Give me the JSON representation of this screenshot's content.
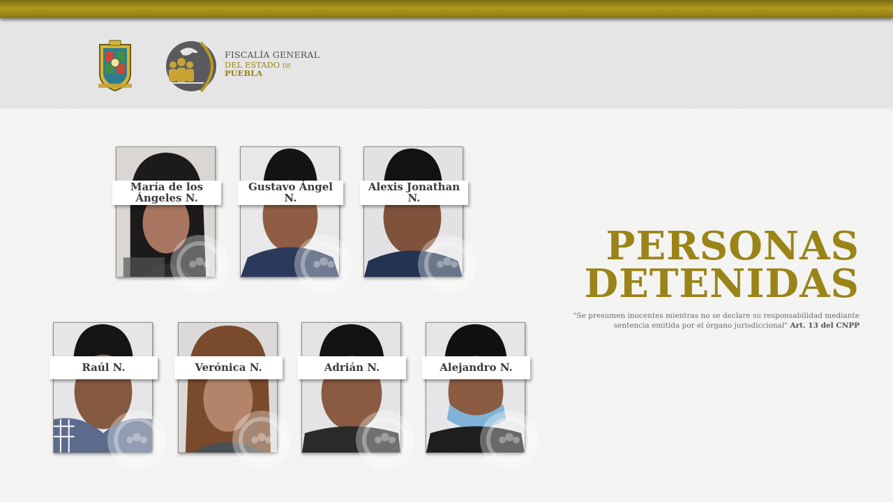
{
  "header": {
    "coat_of_arms": "puebla-coat-of-arms",
    "agency_line1": "FISCALÍA GENERAL",
    "agency_line2_a": "DEL ESTADO",
    "agency_line2_b": "DE",
    "agency_line3": "PUEBLA"
  },
  "title": {
    "line1": "PERSONAS",
    "line2": "DETENIDAS"
  },
  "disclaimer": {
    "line1": "\"Se presumen inocentes mientras no se declare su responsabilidad mediante",
    "line2": "sentencia emitida por el órgano jurisdiccional\"",
    "reference": "Art. 13 del CNPP"
  },
  "detainees": [
    {
      "name": "María de los Ángeles N."
    },
    {
      "name": "Gustavo Ángel N."
    },
    {
      "name": "Alexis Jonathan N."
    },
    {
      "name": "Raúl N."
    },
    {
      "name": "Verónica N."
    },
    {
      "name": "Adrián N."
    },
    {
      "name": "Alejandro N."
    }
  ],
  "colors": {
    "gold": "#9a8418",
    "gold_bar": "#b29a1c",
    "header_bg": "#e5e5e5",
    "label_text": "#3a3a3a"
  }
}
